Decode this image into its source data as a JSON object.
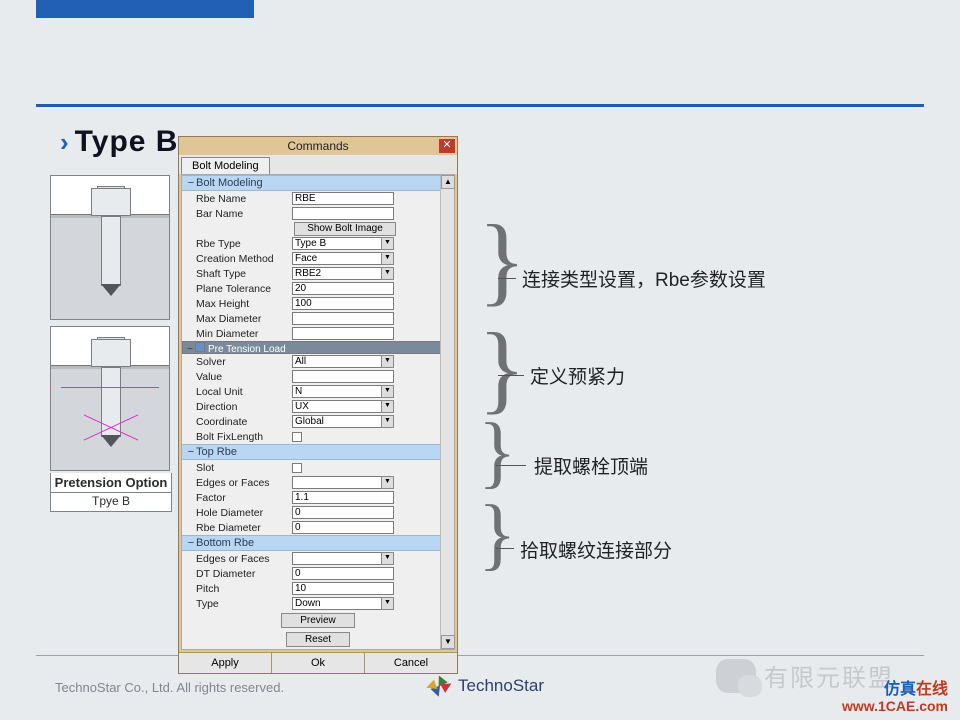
{
  "title": "Type B",
  "dialog": {
    "title": "Commands",
    "tab": "Bolt Modeling",
    "sections": {
      "bolt_modeling": {
        "header": "Bolt Modeling",
        "rbe_name_label": "Rbe Name",
        "rbe_name_value": "RBE",
        "bar_name_label": "Bar Name",
        "bar_name_value": "",
        "show_btn": "Show Bolt Image",
        "rbe_type_label": "Rbe Type",
        "rbe_type_value": "Type B",
        "creation_method_label": "Creation Method",
        "creation_method_value": "Face",
        "shaft_type_label": "Shaft Type",
        "shaft_type_value": "RBE2",
        "plane_tolerance_label": "Plane Tolerance",
        "plane_tolerance_value": "20",
        "max_height_label": "Max Height",
        "max_height_value": "100",
        "max_diameter_label": "Max Diameter",
        "max_diameter_value": "",
        "min_diameter_label": "Min Diameter",
        "min_diameter_value": ""
      },
      "pretension": {
        "header": "Pre Tension Load",
        "solver_label": "Solver",
        "solver_value": "All",
        "value_label": "Value",
        "value_value": "",
        "local_unit_label": "Local Unit",
        "local_unit_value": "N",
        "direction_label": "Direction",
        "direction_value": "UX",
        "coordinate_label": "Coordinate",
        "coordinate_value": "Global",
        "bolt_fixlength_label": "Bolt FixLength"
      },
      "top_rbe": {
        "header": "Top Rbe",
        "slot_label": "Slot",
        "edges_label": "Edges or Faces",
        "edges_value": "",
        "factor_label": "Factor",
        "factor_value": "1.1",
        "hole_dia_label": "Hole Diameter",
        "hole_dia_value": "0",
        "rbe_dia_label": "Rbe Diameter",
        "rbe_dia_value": "0"
      },
      "bottom_rbe": {
        "header": "Bottom Rbe",
        "edges_label": "Edges or Faces",
        "edges_value": "",
        "dt_dia_label": "DT Diameter",
        "dt_dia_value": "0",
        "pitch_label": "Pitch",
        "pitch_value": "10",
        "type_label": "Type",
        "type_value": "Down"
      }
    },
    "preview_btn": "Preview",
    "reset_btn": "Reset",
    "apply_btn": "Apply",
    "ok_btn": "Ok",
    "cancel_btn": "Cancel"
  },
  "diagram_caption": "Pretension Option",
  "diagram_sub": "Tpye B",
  "annotations": {
    "a1": "连接类型设置，Rbe参数设置",
    "a2": "定义预紧力",
    "a3": "提取螺栓顶端",
    "a4": "拾取螺纹连接部分"
  },
  "footer": {
    "copyright": "TechnoStar Co., Ltd. All rights reserved.",
    "logo": "TechnoStar",
    "wechat": "有限元联盟",
    "brand_a": "仿真",
    "brand_b": "在线",
    "url": "www.1CAE.com"
  }
}
